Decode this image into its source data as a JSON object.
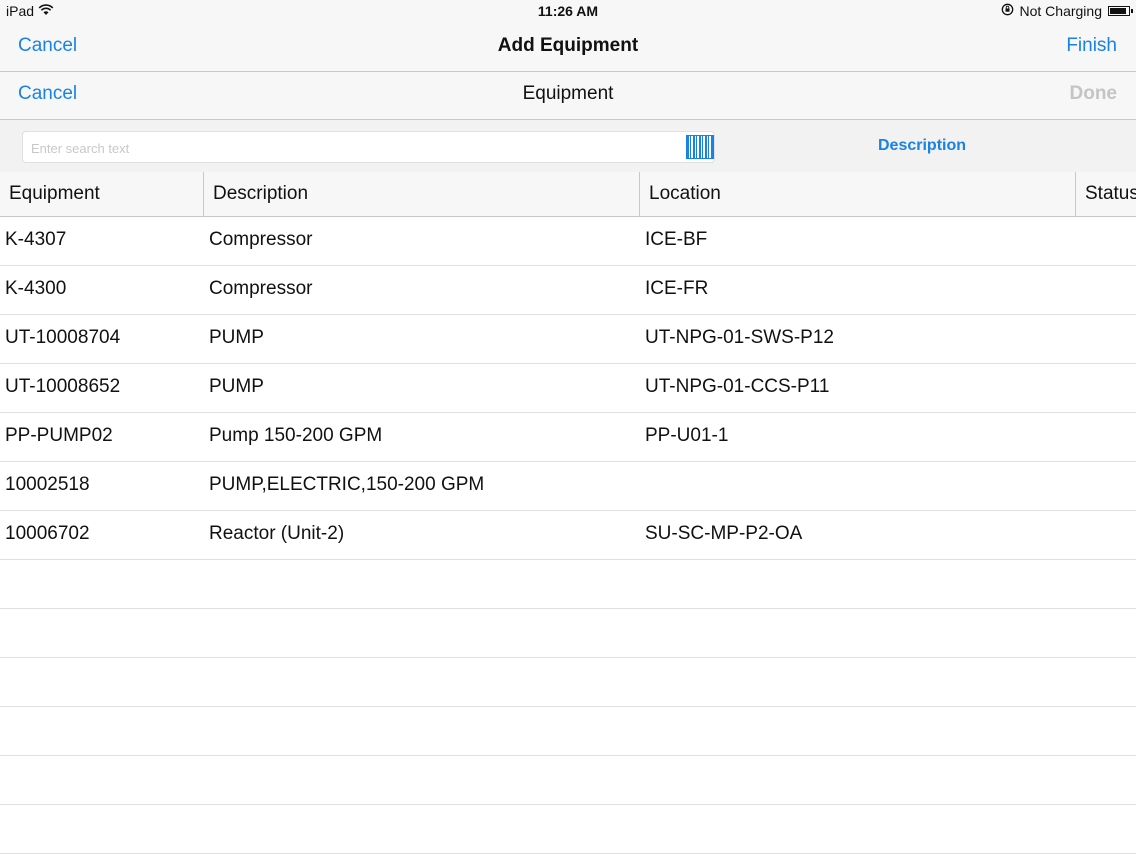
{
  "status_bar": {
    "device": "iPad",
    "time": "11:26 AM",
    "charging": "Not Charging"
  },
  "top_nav": {
    "cancel_label": "Cancel",
    "title": "Add Equipment",
    "finish_label": "Finish"
  },
  "sub_nav": {
    "cancel_label": "Cancel",
    "title": "Equipment",
    "done_label": "Done"
  },
  "search": {
    "placeholder": "Enter search text",
    "value": "",
    "sort_label": "Description"
  },
  "table": {
    "columns": [
      "Equipment",
      "Description",
      "Location",
      "Status"
    ],
    "rows": [
      {
        "equipment": "K-4307",
        "description": "Compressor",
        "location": "ICE-BF",
        "status": ""
      },
      {
        "equipment": "K-4300",
        "description": "Compressor",
        "location": "ICE-FR",
        "status": ""
      },
      {
        "equipment": "UT-10008704",
        "description": "PUMP",
        "location": "UT-NPG-01-SWS-P12",
        "status": ""
      },
      {
        "equipment": "UT-10008652",
        "description": "PUMP",
        "location": "UT-NPG-01-CCS-P11",
        "status": ""
      },
      {
        "equipment": "PP-PUMP02",
        "description": "Pump 150-200 GPM",
        "location": "PP-U01-1",
        "status": ""
      },
      {
        "equipment": "10002518",
        "description": "PUMP,ELECTRIC,150-200 GPM",
        "location": "",
        "status": ""
      },
      {
        "equipment": "10006702",
        "description": "Reactor (Unit-2)",
        "location": "SU-SC-MP-P2-OA",
        "status": ""
      }
    ]
  },
  "colors": {
    "accent": "#1a82e2",
    "disabled": "#c4c4c4"
  }
}
